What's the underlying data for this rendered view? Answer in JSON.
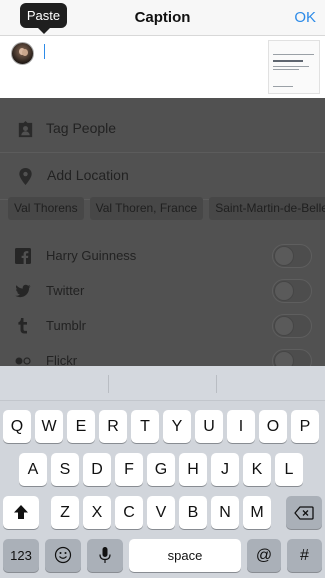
{
  "header": {
    "title": "Caption",
    "ok_label": "OK"
  },
  "paste_bubble": {
    "label": "Paste"
  },
  "caption": {
    "value": ""
  },
  "options": {
    "tag_people": "Tag People",
    "add_location": "Add Location"
  },
  "location_suggestions": [
    "Val Thorens",
    "Val Thoren, France",
    "Saint-Martin-de-Belle"
  ],
  "share": [
    {
      "label": "Harry Guinness",
      "icon": "facebook-icon",
      "enabled": false
    },
    {
      "label": "Twitter",
      "icon": "twitter-icon",
      "enabled": false
    },
    {
      "label": "Tumblr",
      "icon": "tumblr-icon",
      "enabled": false
    },
    {
      "label": "Flickr",
      "icon": "flickr-icon",
      "enabled": false
    }
  ],
  "keyboard": {
    "row1": [
      "Q",
      "W",
      "E",
      "R",
      "T",
      "Y",
      "U",
      "I",
      "O",
      "P"
    ],
    "row2": [
      "A",
      "S",
      "D",
      "F",
      "G",
      "H",
      "J",
      "K",
      "L"
    ],
    "row3": [
      "Z",
      "X",
      "C",
      "V",
      "B",
      "N",
      "M"
    ],
    "numbers_key": "123",
    "space_key": "space",
    "at_key": "@",
    "hash_key": "#"
  },
  "colors": {
    "accent": "#2d8be8",
    "overlay": "#515151",
    "keyboard_bg": "#d1d5db"
  }
}
